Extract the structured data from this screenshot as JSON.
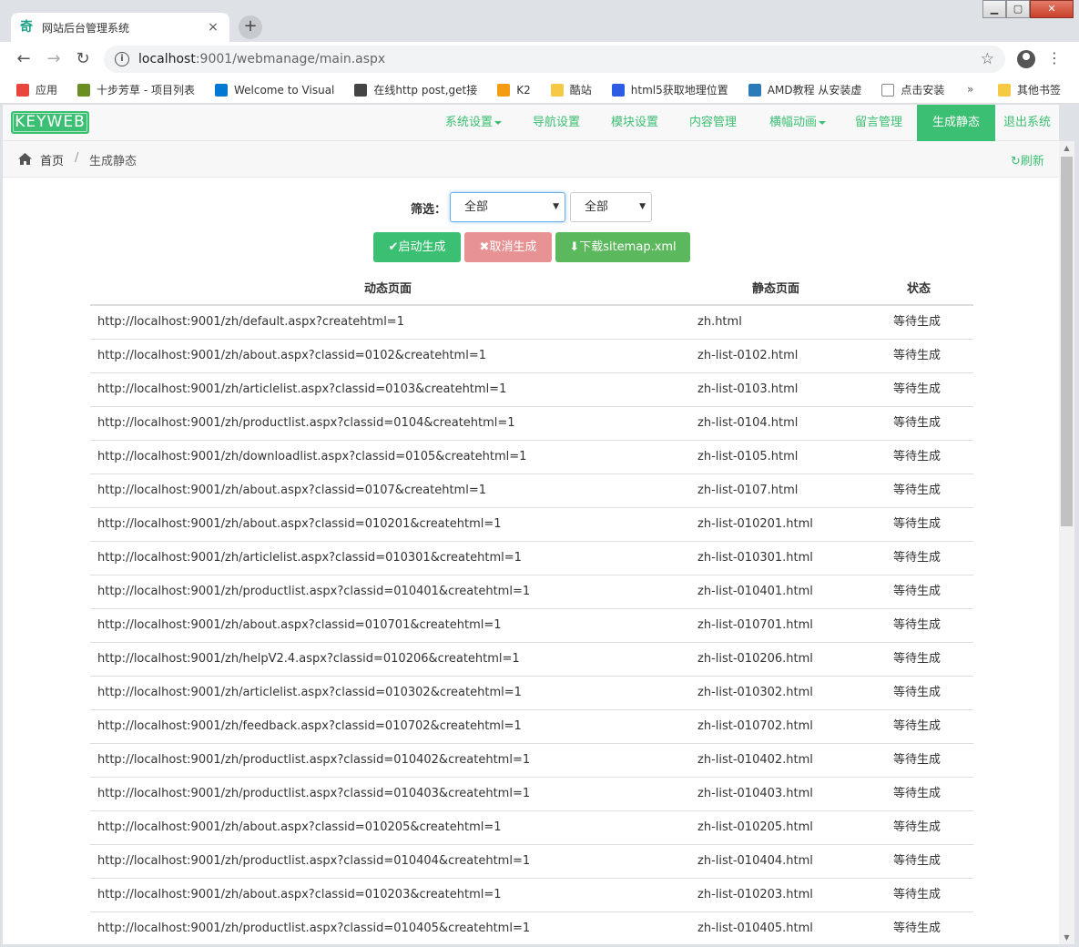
{
  "browser": {
    "tab_title": "网站后台管理系统",
    "tab_favicon": "奇",
    "url_host": "localhost",
    "url_rest": ":9001/webmanage/main.aspx",
    "bookmarks": [
      {
        "label": "应用",
        "icon": "apps-icon",
        "color": "#e8453c"
      },
      {
        "label": "十步芳草 - 项目列表",
        "icon": "bookmark-icon",
        "color": "#6b8e23"
      },
      {
        "label": "Welcome to Visual",
        "icon": "vs-icon",
        "color": "#0078d4"
      },
      {
        "label": "在线http post,get接",
        "icon": "qr-icon",
        "color": "#444444"
      },
      {
        "label": "K2",
        "icon": "k2-icon",
        "color": "#f39c12"
      },
      {
        "label": "酷站",
        "icon": "folder-icon",
        "color": "#f6c945"
      },
      {
        "label": "html5获取地理位置",
        "icon": "paw-icon",
        "color": "#2d5be3"
      },
      {
        "label": "AMD教程 从安装虚",
        "icon": "amd-icon",
        "color": "#2b7bb9"
      },
      {
        "label": "点击安装",
        "icon": "page-icon",
        "color": "#ffffff"
      }
    ],
    "bookmarks_more": "»",
    "other_bookmarks": "其他书签"
  },
  "navbar": {
    "brand": "KEYWEB",
    "items": [
      {
        "label": "系统设置",
        "dropdown": true
      },
      {
        "label": "导航设置",
        "dropdown": false
      },
      {
        "label": "模块设置",
        "dropdown": false
      },
      {
        "label": "内容管理",
        "dropdown": false
      },
      {
        "label": "横幅动画",
        "dropdown": true
      },
      {
        "label": "留言管理",
        "dropdown": false
      },
      {
        "label": "生成静态",
        "dropdown": false,
        "active": true
      },
      {
        "label": "退出系统",
        "dropdown": false
      }
    ]
  },
  "breadcrumb": {
    "home": "首页",
    "separator": "/",
    "current": "生成静态",
    "refresh": "刷新"
  },
  "filter": {
    "label": "筛选：",
    "select1_value": "全部",
    "select2_value": "全部"
  },
  "buttons": {
    "start": "✔启动生成",
    "cancel": "✖取消生成",
    "download": "⬇下载sitemap.xml"
  },
  "table": {
    "headers": [
      "动态页面",
      "静态页面",
      "状态"
    ],
    "rows": [
      [
        "http://localhost:9001/zh/default.aspx?createhtml=1",
        "zh.html",
        "等待生成"
      ],
      [
        "http://localhost:9001/zh/about.aspx?classid=0102&createhtml=1",
        "zh-list-0102.html",
        "等待生成"
      ],
      [
        "http://localhost:9001/zh/articlelist.aspx?classid=0103&createhtml=1",
        "zh-list-0103.html",
        "等待生成"
      ],
      [
        "http://localhost:9001/zh/productlist.aspx?classid=0104&createhtml=1",
        "zh-list-0104.html",
        "等待生成"
      ],
      [
        "http://localhost:9001/zh/downloadlist.aspx?classid=0105&createhtml=1",
        "zh-list-0105.html",
        "等待生成"
      ],
      [
        "http://localhost:9001/zh/about.aspx?classid=0107&createhtml=1",
        "zh-list-0107.html",
        "等待生成"
      ],
      [
        "http://localhost:9001/zh/about.aspx?classid=010201&createhtml=1",
        "zh-list-010201.html",
        "等待生成"
      ],
      [
        "http://localhost:9001/zh/articlelist.aspx?classid=010301&createhtml=1",
        "zh-list-010301.html",
        "等待生成"
      ],
      [
        "http://localhost:9001/zh/productlist.aspx?classid=010401&createhtml=1",
        "zh-list-010401.html",
        "等待生成"
      ],
      [
        "http://localhost:9001/zh/about.aspx?classid=010701&createhtml=1",
        "zh-list-010701.html",
        "等待生成"
      ],
      [
        "http://localhost:9001/zh/helpV2.4.aspx?classid=010206&createhtml=1",
        "zh-list-010206.html",
        "等待生成"
      ],
      [
        "http://localhost:9001/zh/articlelist.aspx?classid=010302&createhtml=1",
        "zh-list-010302.html",
        "等待生成"
      ],
      [
        "http://localhost:9001/zh/feedback.aspx?classid=010702&createhtml=1",
        "zh-list-010702.html",
        "等待生成"
      ],
      [
        "http://localhost:9001/zh/productlist.aspx?classid=010402&createhtml=1",
        "zh-list-010402.html",
        "等待生成"
      ],
      [
        "http://localhost:9001/zh/productlist.aspx?classid=010403&createhtml=1",
        "zh-list-010403.html",
        "等待生成"
      ],
      [
        "http://localhost:9001/zh/about.aspx?classid=010205&createhtml=1",
        "zh-list-010205.html",
        "等待生成"
      ],
      [
        "http://localhost:9001/zh/productlist.aspx?classid=010404&createhtml=1",
        "zh-list-010404.html",
        "等待生成"
      ],
      [
        "http://localhost:9001/zh/about.aspx?classid=010203&createhtml=1",
        "zh-list-010203.html",
        "等待生成"
      ],
      [
        "http://localhost:9001/zh/productlist.aspx?classid=010405&createhtml=1",
        "zh-list-010405.html",
        "等待生成"
      ]
    ]
  },
  "colors": {
    "accent": "#3bbf72",
    "cancel": "#e89393",
    "download": "#5cb85c"
  }
}
